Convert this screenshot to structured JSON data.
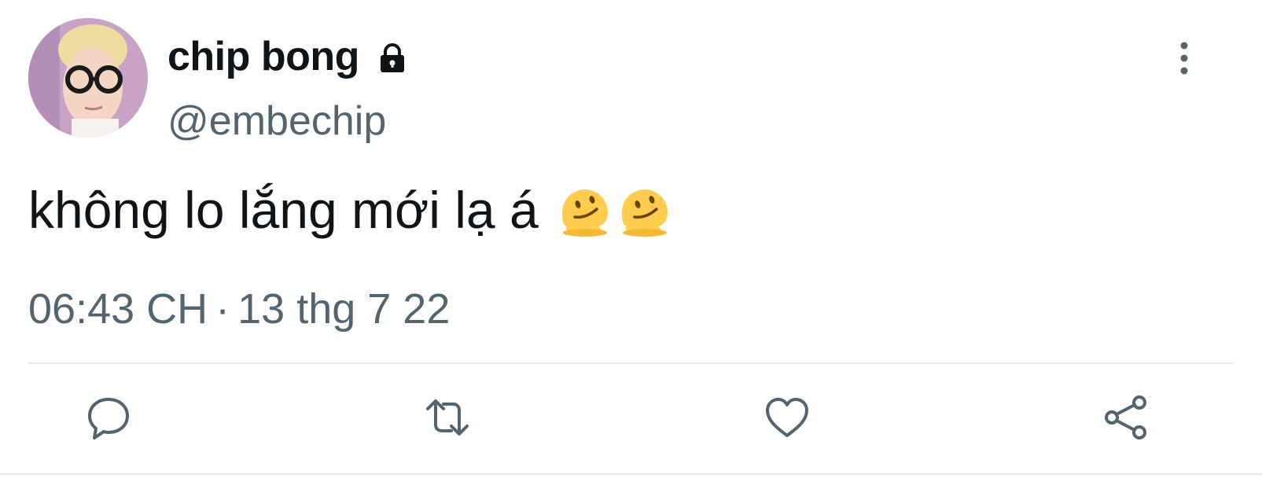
{
  "tweet": {
    "display_name": "chip bong",
    "handle": "@embechip",
    "text": "không lo lắng mới lạ á",
    "emojis": [
      "melting-face-emoji",
      "melting-face-emoji"
    ],
    "time": "06:43 CH",
    "separator": "·",
    "date": "13 thg 7 22",
    "icons": {
      "lock": "lock-icon",
      "more": "more-vertical-icon",
      "reply": "reply-icon",
      "retweet": "retweet-icon",
      "like": "heart-icon",
      "share": "share-icon"
    }
  },
  "colors": {
    "text_primary": "#0f1419",
    "text_secondary": "#536471",
    "divider": "#e6e9eb",
    "emoji_yellow": "#ffcc4d"
  }
}
